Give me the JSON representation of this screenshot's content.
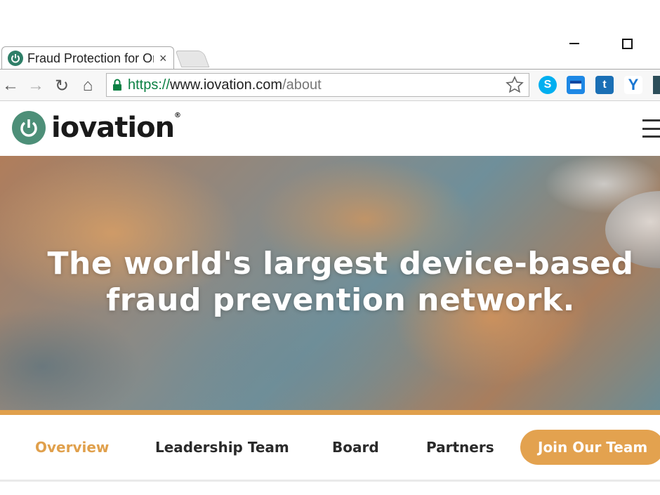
{
  "browser": {
    "tab": {
      "title": "Fraud Protection for Online Businesses",
      "close_glyph": "×",
      "favicon": "iovation-power-icon"
    },
    "window_controls": {
      "minimize": "minimize-icon",
      "maximize": "maximize-icon"
    },
    "toolbar": {
      "back_icon": "←",
      "forward_icon": "→",
      "reload_icon": "↻",
      "home_icon": "⌂",
      "url": {
        "scheme": "https://",
        "host": "www.iovation.com",
        "path": "/about"
      },
      "bookmark_icon": "star-icon"
    },
    "extensions": [
      {
        "name": "skype-icon",
        "glyph": "S",
        "color": "#00aff0"
      },
      {
        "name": "reader-icon",
        "glyph": "",
        "color": "#1e88e5"
      },
      {
        "name": "twitter-icon",
        "glyph": "t",
        "color": "#1a6fb5"
      },
      {
        "name": "y-icon",
        "glyph": "Y",
        "color": "#1976d2"
      }
    ]
  },
  "site": {
    "logo": {
      "text": "iovation",
      "reg": "®",
      "color": "#4d8f78"
    },
    "menu_icon": "hamburger-icon",
    "hero": {
      "line1": "The world's largest device-based",
      "line2": "fraud prevention network."
    },
    "accent_color": "#e0a04c",
    "subnav": {
      "items": [
        {
          "label": "Overview",
          "active": true
        },
        {
          "label": "Leadership Team",
          "active": false
        },
        {
          "label": "Board",
          "active": false
        },
        {
          "label": "Partners",
          "active": false
        }
      ],
      "cta": "Join Our Team"
    }
  }
}
